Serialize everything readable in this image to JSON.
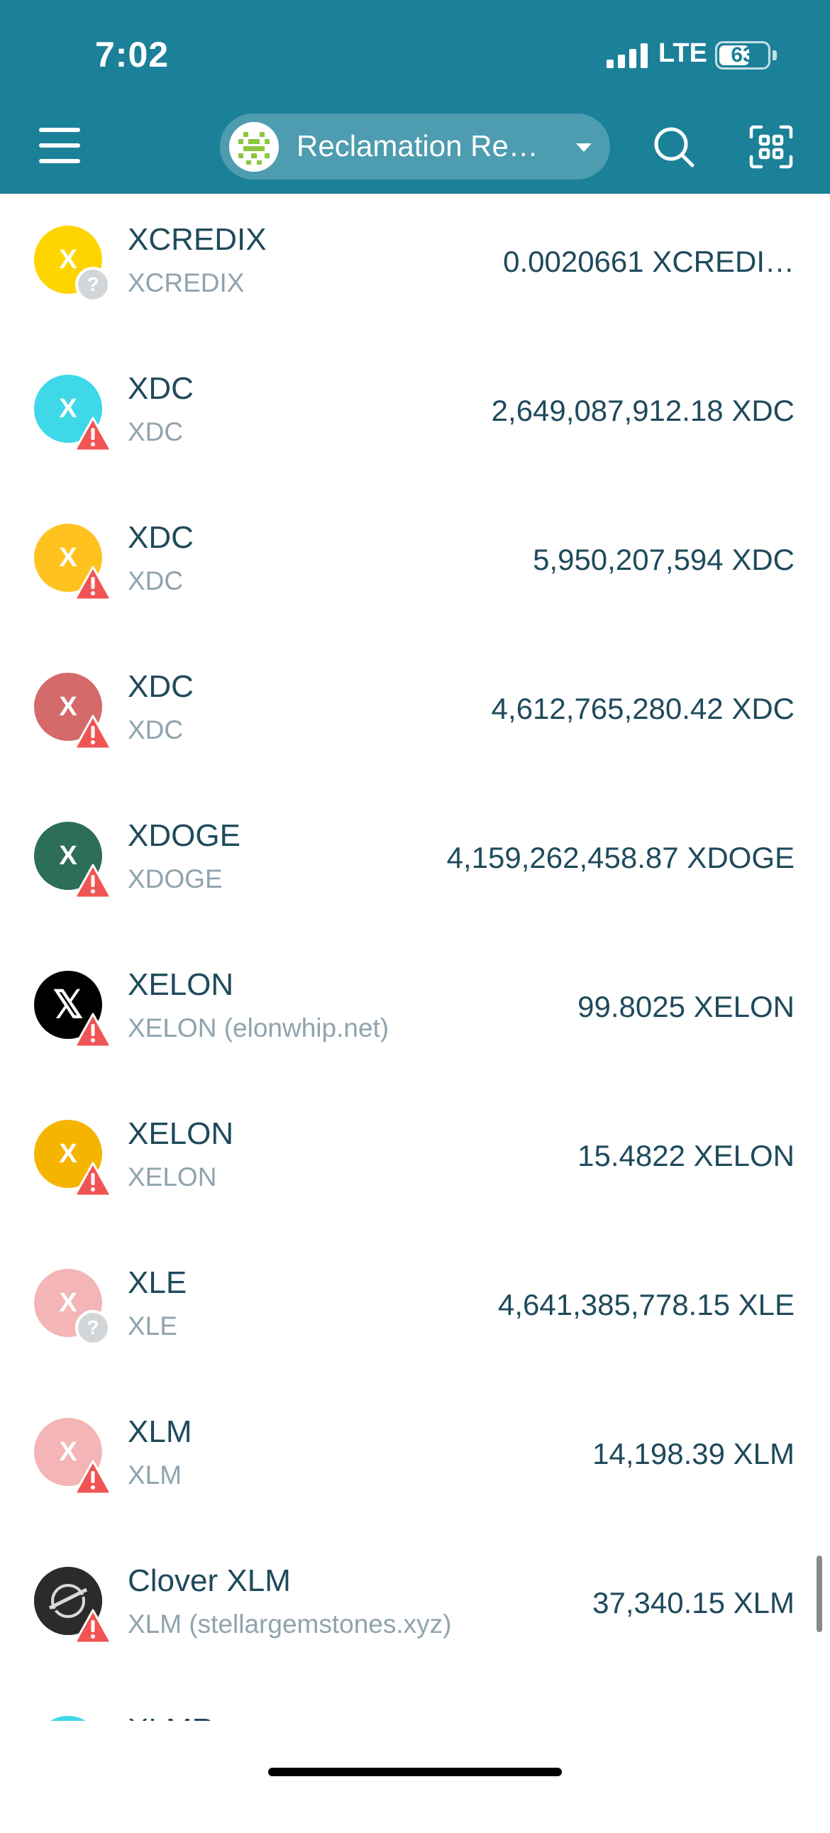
{
  "status_bar": {
    "time": "7:02",
    "network": "LTE",
    "battery": "63",
    "battery_level": 0.63
  },
  "header": {
    "wallet_name": "Reclamation Re…"
  },
  "colors": {
    "header_bg": "#1b8199",
    "warning": "#f05454",
    "unknown_badge": "#d3d6d9"
  },
  "tokens": [
    {
      "name": "XCREDIX",
      "subtitle": "XCREDIX",
      "balance": "0.0020661 XCREDI…",
      "icon_letter": "X",
      "icon_color": "#ffd500",
      "badge": "unknown-icon"
    },
    {
      "name": "XDC",
      "subtitle": "XDC",
      "balance": "2,649,087,912.18 XDC",
      "icon_letter": "X",
      "icon_color": "#3ed8e8",
      "badge": "warning-icon"
    },
    {
      "name": "XDC",
      "subtitle": "XDC",
      "balance": "5,950,207,594 XDC",
      "icon_letter": "X",
      "icon_color": "#ffc21f",
      "badge": "warning-icon"
    },
    {
      "name": "XDC",
      "subtitle": "XDC",
      "balance": "4,612,765,280.42 XDC",
      "icon_letter": "X",
      "icon_color": "#d46a6a",
      "badge": "warning-icon"
    },
    {
      "name": "XDOGE",
      "subtitle": "XDOGE",
      "balance": "4,159,262,458.87 XDOGE",
      "icon_letter": "X",
      "icon_color": "#2c6e57",
      "badge": "warning-icon"
    },
    {
      "name": "XELON",
      "subtitle": "XELON (elonwhip.net)",
      "balance": "99.8025 XELON",
      "icon_letter": "𝕏",
      "icon_color": "#000000",
      "badge": "warning-icon"
    },
    {
      "name": "XELON",
      "subtitle": "XELON",
      "balance": "15.4822 XELON",
      "icon_letter": "X",
      "icon_color": "#f5b400",
      "badge": "warning-icon"
    },
    {
      "name": "XLE",
      "subtitle": "XLE",
      "balance": "4,641,385,778.15 XLE",
      "icon_letter": "X",
      "icon_color": "#f3b5b5",
      "badge": "unknown-icon"
    },
    {
      "name": "XLM",
      "subtitle": "XLM",
      "balance": "14,198.39 XLM",
      "icon_letter": "X",
      "icon_color": "#f3b5b5",
      "badge": "warning-icon"
    },
    {
      "name": "Clover XLM",
      "subtitle": "XLM (stellargemstones.xyz)",
      "balance": "37,340.15 XLM",
      "icon_letter": "",
      "icon_color": "#2b2b2b",
      "badge": "warning-icon"
    },
    {
      "name": "XLMR",
      "subtitle": "",
      "balance": "",
      "icon_letter": "",
      "icon_color": "#3ed8e8",
      "badge": ""
    }
  ]
}
